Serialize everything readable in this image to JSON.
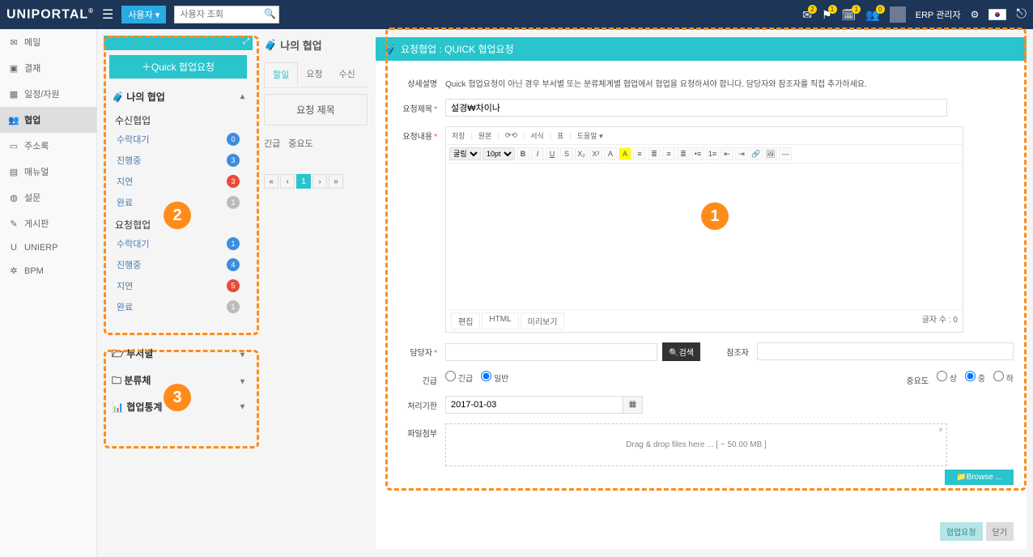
{
  "header": {
    "logo": "UNIPORTAL",
    "user_button": "사용자 ▾",
    "search_placeholder": "사용자 조회",
    "icons": [
      {
        "name": "mail-icon",
        "badge": "2"
      },
      {
        "name": "alert-icon",
        "badge": "1"
      },
      {
        "name": "calendar-icon",
        "badge": "1"
      },
      {
        "name": "group-icon",
        "badge": "0"
      }
    ],
    "erp_label": "ERP 관리자"
  },
  "nav": [
    {
      "icon": "✉",
      "label": "메일"
    },
    {
      "icon": "▣",
      "label": "결재"
    },
    {
      "icon": "▦",
      "label": "일정/자원"
    },
    {
      "icon": "👥",
      "label": "협업",
      "active": true
    },
    {
      "icon": "▭",
      "label": "주소록"
    },
    {
      "icon": "▤",
      "label": "매뉴얼"
    },
    {
      "icon": "◍",
      "label": "설문"
    },
    {
      "icon": "✎",
      "label": "게시판"
    },
    {
      "icon": "U",
      "label": "UNIERP"
    },
    {
      "icon": "✲",
      "label": "BPM"
    }
  ],
  "sidebar": {
    "quick": "＋Quick 협업요청",
    "section1": "나의 협업",
    "recv_title": "수신협업",
    "recv": [
      {
        "label": "수락대기",
        "count": "0",
        "cls": "c-blue"
      },
      {
        "label": "진행중",
        "count": "3",
        "cls": "c-blue"
      },
      {
        "label": "지연",
        "count": "3",
        "cls": "c-red"
      },
      {
        "label": "완료",
        "count": "1",
        "cls": "c-grey"
      }
    ],
    "req_title": "요청협업",
    "req": [
      {
        "label": "수락대기",
        "count": "1",
        "cls": "c-blue"
      },
      {
        "label": "진행중",
        "count": "4",
        "cls": "c-blue"
      },
      {
        "label": "지연",
        "count": "5",
        "cls": "c-red"
      },
      {
        "label": "완료",
        "count": "1",
        "cls": "c-grey"
      }
    ],
    "cats": [
      {
        "icon": "🗁",
        "label": "부서별"
      },
      {
        "icon": "🗀",
        "label": "분류체"
      },
      {
        "icon": "📊",
        "label": "협업통계"
      }
    ]
  },
  "mid": {
    "title": "나의 협업",
    "tabs": [
      "할일",
      "요청",
      "수신"
    ],
    "col_header": "요청 제목",
    "filter1": "긴급",
    "filter2": "중요도"
  },
  "form": {
    "header": "요청협업 : QUICK 협업요청",
    "desc_label": "상세설명",
    "desc_text": "Quick 협업요청이 아닌 경우 부서별 또는 분류체계별 협업에서 협업을 요청하셔야 합니다. 담당자와 참조자를 직접 추가하세요.",
    "title_label": "요청제목",
    "title_value": "설경₩차이나",
    "body_label": "요청내용",
    "tb1": [
      "저장",
      "원본",
      "⟳⟲",
      "서식",
      "표",
      "도움말 ▾"
    ],
    "font_family": "굴림",
    "font_size": "10pt",
    "etabs": [
      "편집",
      "HTML",
      "미리보기"
    ],
    "charcount": "글자 수 : 0",
    "assignee_label": "담당자",
    "search_btn": "🔍검색",
    "cc_label": "참조자",
    "urgent_label": "긴급",
    "urgent_opts": [
      "긴급",
      "일반"
    ],
    "priority_label": "중요도",
    "priority_opts": [
      "상",
      "중",
      "하"
    ],
    "deadline_label": "처리기한",
    "deadline_value": "2017-01-03",
    "attach_label": "파일첨부",
    "dropzone": "Drag & drop files here ... [ ~ 50.00 MB ]",
    "browse": "📁Browse ...",
    "submit": "협업요청",
    "close": "닫기"
  }
}
